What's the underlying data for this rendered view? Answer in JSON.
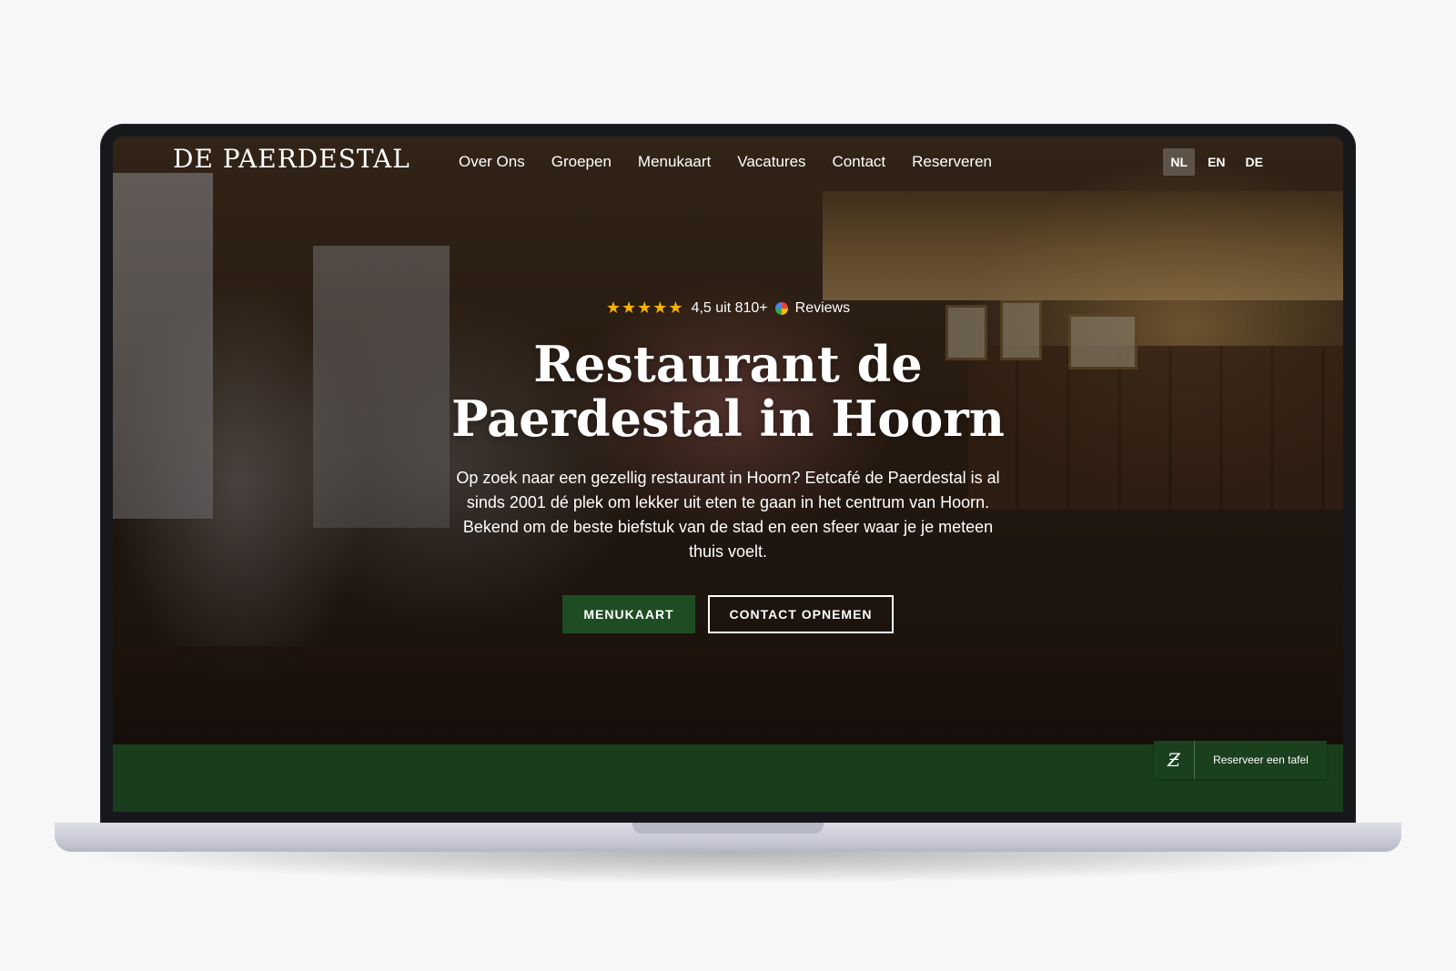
{
  "brand": {
    "logo_text": "DE PAERDESTAL"
  },
  "nav": {
    "items": [
      {
        "label": "Over Ons"
      },
      {
        "label": "Groepen"
      },
      {
        "label": "Menukaart"
      },
      {
        "label": "Vacatures"
      },
      {
        "label": "Contact"
      },
      {
        "label": "Reserveren"
      }
    ]
  },
  "languages": {
    "items": [
      {
        "label": "NL",
        "active": true
      },
      {
        "label": "EN",
        "active": false
      },
      {
        "label": "DE",
        "active": false
      }
    ]
  },
  "hero": {
    "rating": {
      "stars": "★★★★★",
      "text": "4,5 uit 810+",
      "source": "Reviews",
      "star_color": "#f5b301",
      "star_count": 5
    },
    "title_line1": "Restaurant de",
    "title_line2": "Paerdestal in Hoorn",
    "description": "Op zoek naar een gezellig restaurant in Hoorn? Eetcafé de Paerdestal is al sinds 2001 dé plek om lekker uit eten te gaan in het centrum van Hoorn. Bekend om de beste biefstuk van de stad en een sfeer waar je je meteen thuis voelt.",
    "buttons": {
      "primary": "MENUKAART",
      "secondary": "CONTACT OPNEMEN"
    }
  },
  "reserve_widget": {
    "icon": "z-logo-icon",
    "label": "Reserveer een tafel"
  },
  "colors": {
    "brand_green": "#1f4d23",
    "band_green": "#1a3d1c",
    "text": "#ffffff"
  }
}
